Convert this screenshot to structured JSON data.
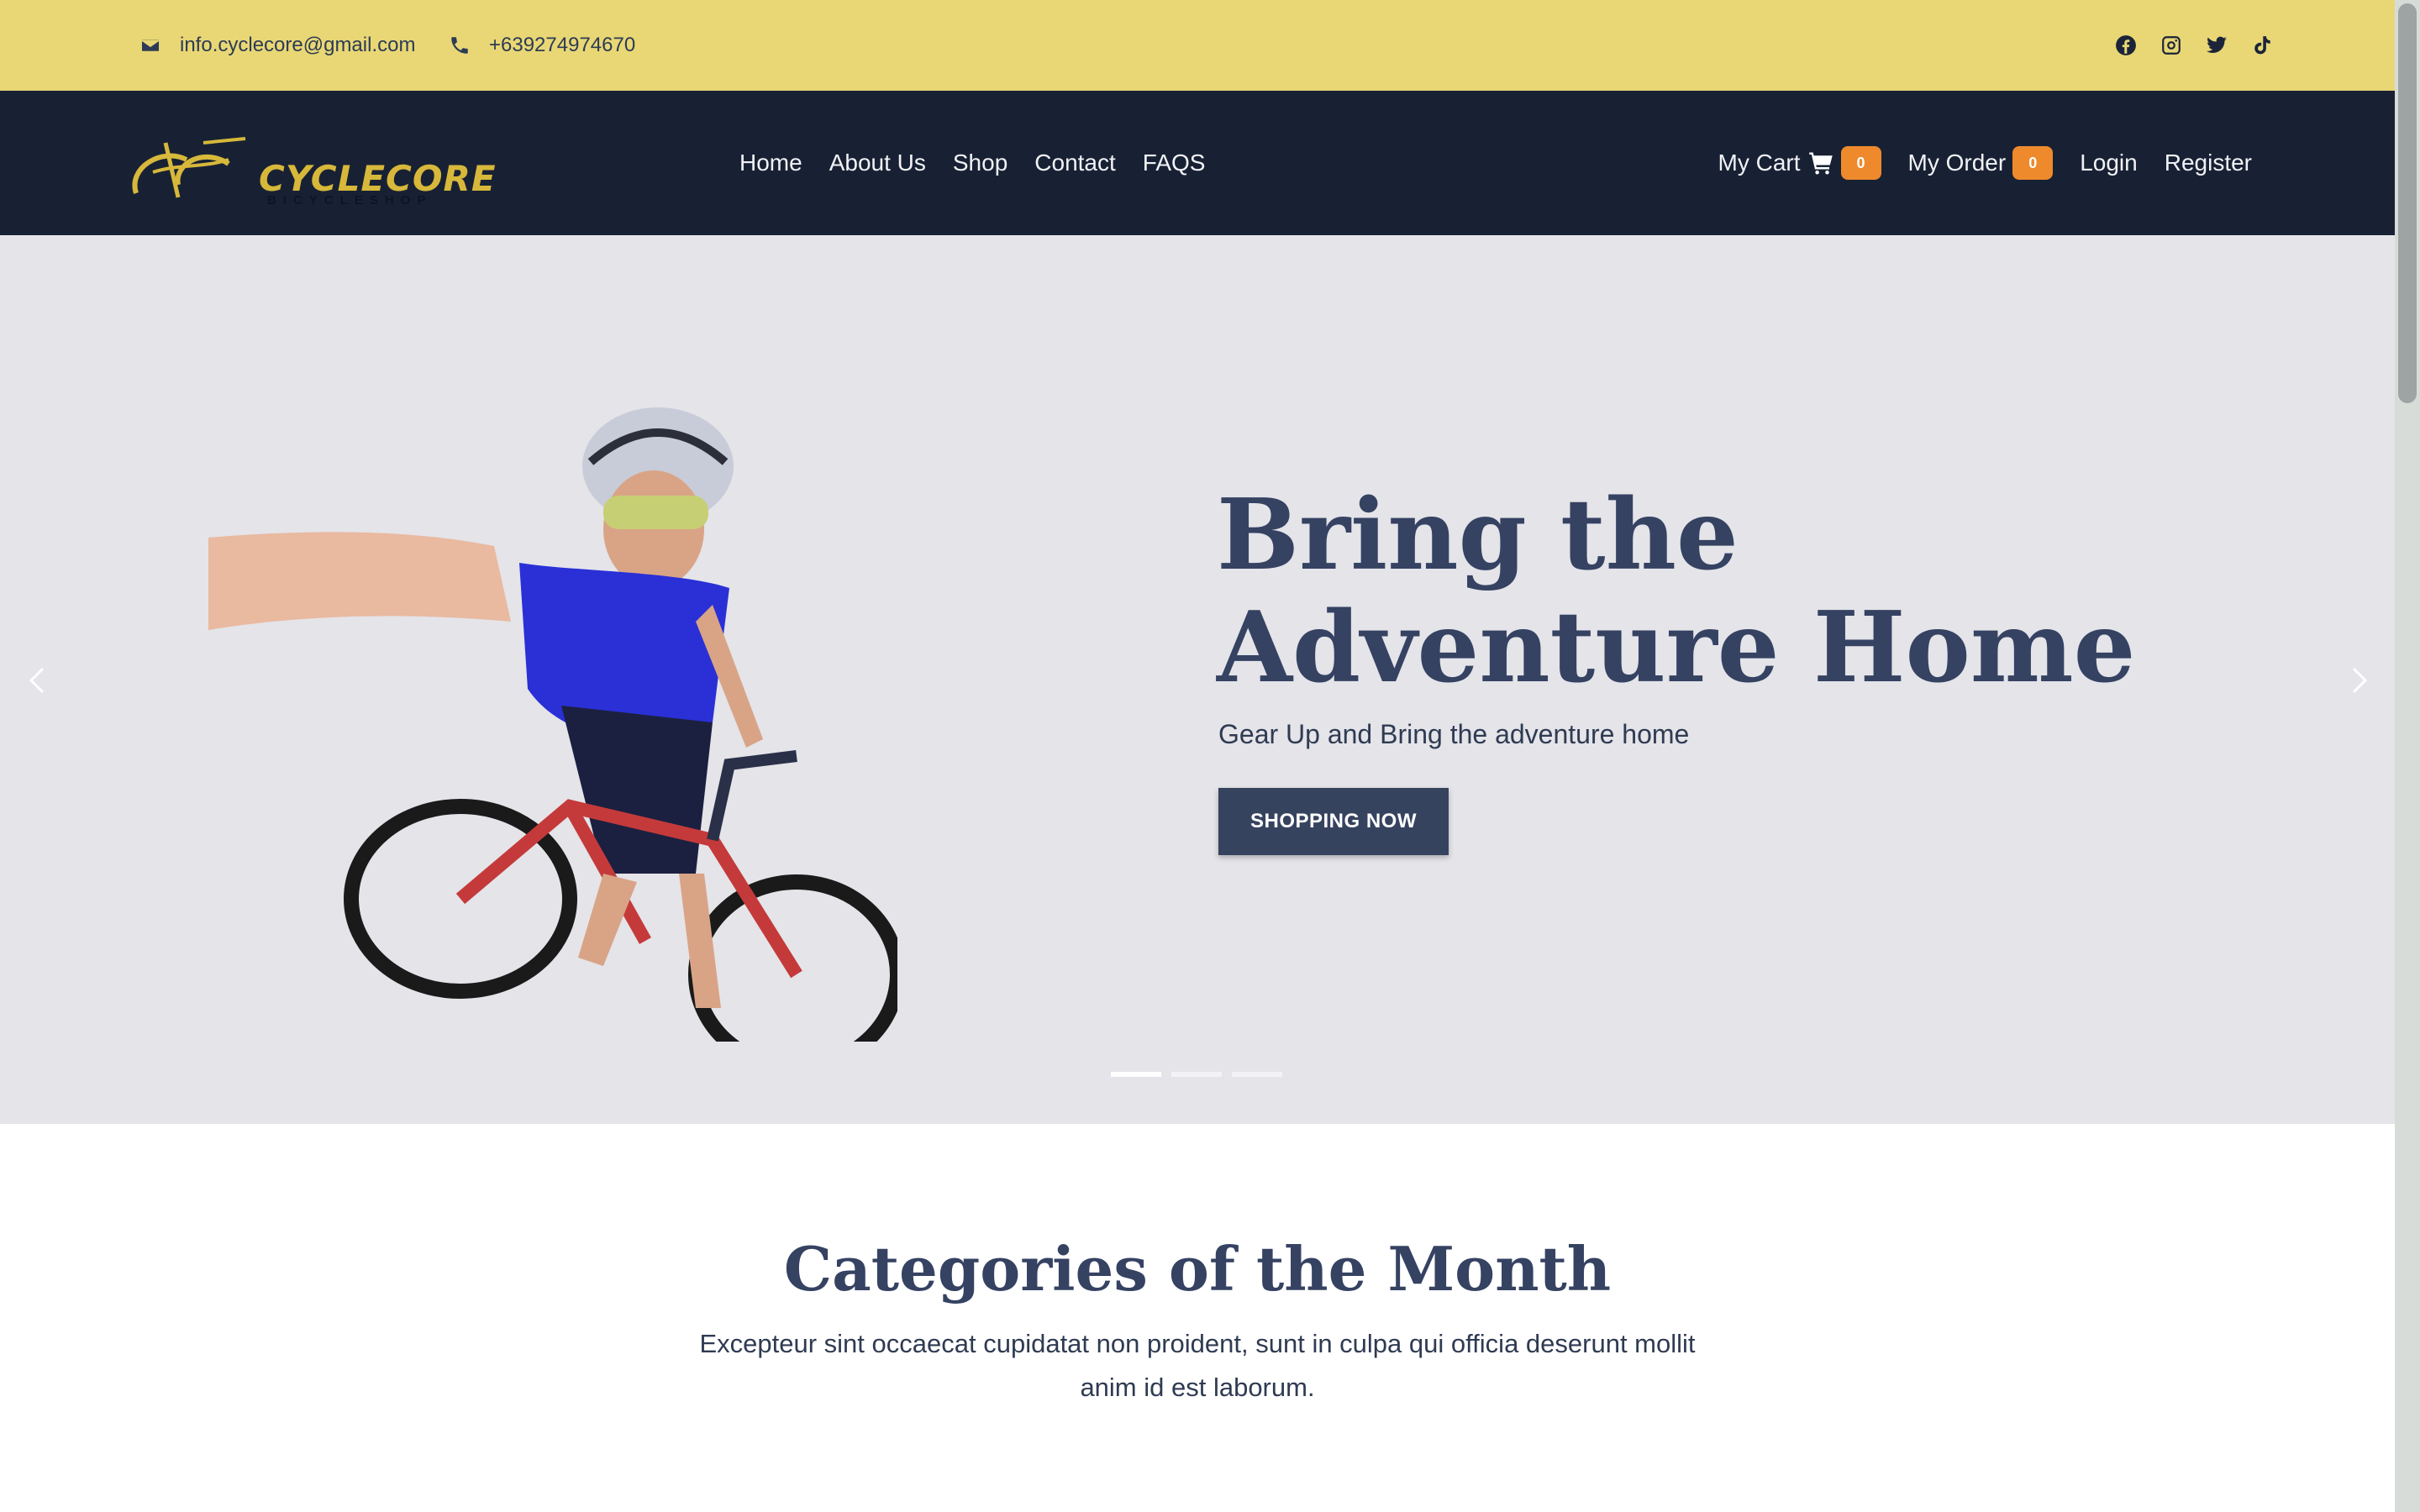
{
  "topbar": {
    "email": "info.cyclecore@gmail.com",
    "phone": "+639274974670",
    "socials": [
      "facebook-icon",
      "instagram-icon",
      "twitter-icon",
      "tiktok-icon"
    ]
  },
  "navbar": {
    "logo_text": "CYCLECORE",
    "logo_subtext": "BICYCLESHOP",
    "links": [
      "Home",
      "About Us",
      "Shop",
      "Contact",
      "FAQS"
    ],
    "cart_label": "My Cart",
    "cart_count": "0",
    "order_label": "My Order",
    "order_count": "0",
    "login_label": "Login",
    "register_label": "Register"
  },
  "hero": {
    "title": "Bring the Adventure Home",
    "subtitle": "Gear Up and Bring the adventure home",
    "button_label": "SHOPPING NOW",
    "slides_count": 3,
    "active_slide": 1
  },
  "categories": {
    "title": "Categories of the Month",
    "description": "Excepteur sint occaecat cupidatat non proident, sunt in culpa qui officia deserunt mollit anim id est laborum."
  },
  "colors": {
    "topbar_bg": "#e8d774",
    "navbar_bg": "#182134",
    "hero_bg": "#e4e4e9",
    "accent": "#36435f",
    "badge": "#ee8a2c",
    "logo_gold": "#d7b83a"
  }
}
